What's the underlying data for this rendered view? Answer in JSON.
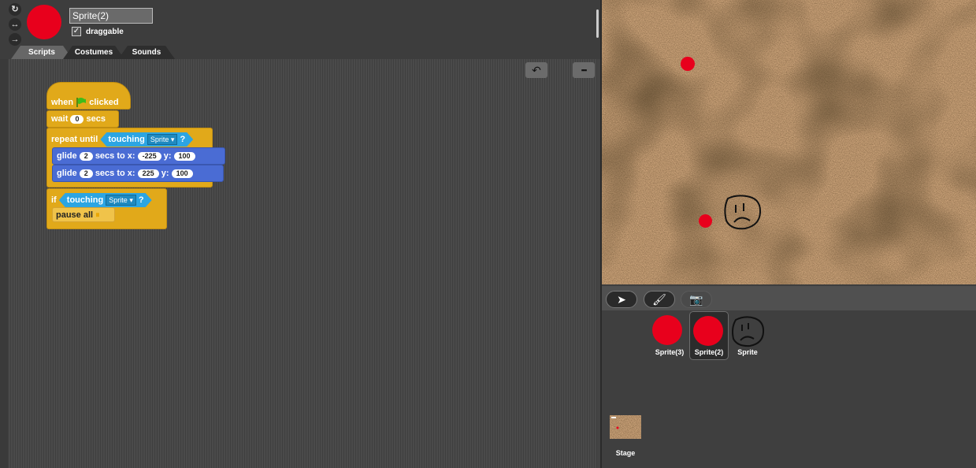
{
  "sprite": {
    "name": "Sprite(2)",
    "draggable_label": "draggable",
    "draggable_checked": true
  },
  "rotation_buttons": [
    {
      "icon": "rotate-icon",
      "glyph": "↻"
    },
    {
      "icon": "left-right-icon",
      "glyph": "↔"
    },
    {
      "icon": "no-rotate-icon",
      "glyph": "→"
    }
  ],
  "tabs": [
    {
      "label": "Scripts",
      "active": true
    },
    {
      "label": "Costumes",
      "active": false
    },
    {
      "label": "Sounds",
      "active": false
    }
  ],
  "toolbar": {
    "undo_icon": "undo-icon",
    "keyboard_icon": "keyboard-icon"
  },
  "script": {
    "hat": {
      "when": "when",
      "clicked": "clicked"
    },
    "wait": {
      "label": "wait",
      "value": "0",
      "unit": "secs"
    },
    "repeat_until": {
      "label": "repeat until",
      "touching": "touching",
      "target": "Sprite",
      "q": "?"
    },
    "glide1": {
      "label": "glide",
      "secs": "2",
      "to": "secs to x:",
      "x": "-225",
      "ylabel": "y:",
      "y": "100"
    },
    "glide2": {
      "label": "glide",
      "secs": "2",
      "to": "secs to x:",
      "x": "225",
      "ylabel": "y:",
      "y": "100"
    },
    "if_block": {
      "label": "if",
      "touching": "touching",
      "target": "Sprite",
      "q": "?"
    },
    "pause": {
      "label": "pause all"
    }
  },
  "stage_buttons": [
    {
      "icon": "arrow-icon"
    },
    {
      "icon": "paintbrush-icon"
    },
    {
      "icon": "camera-icon",
      "disabled": true
    }
  ],
  "corral": {
    "sprites": [
      {
        "label": "Sprite(3)",
        "selected": false
      },
      {
        "label": "Sprite(2)",
        "selected": true
      },
      {
        "label": "Sprite",
        "selected": false
      }
    ],
    "stage_label": "Stage"
  },
  "colors": {
    "control": "#e1a91a",
    "motion": "#4a6cd4",
    "sensing": "#2ca5e2",
    "sprite_red": "#e8001c"
  }
}
